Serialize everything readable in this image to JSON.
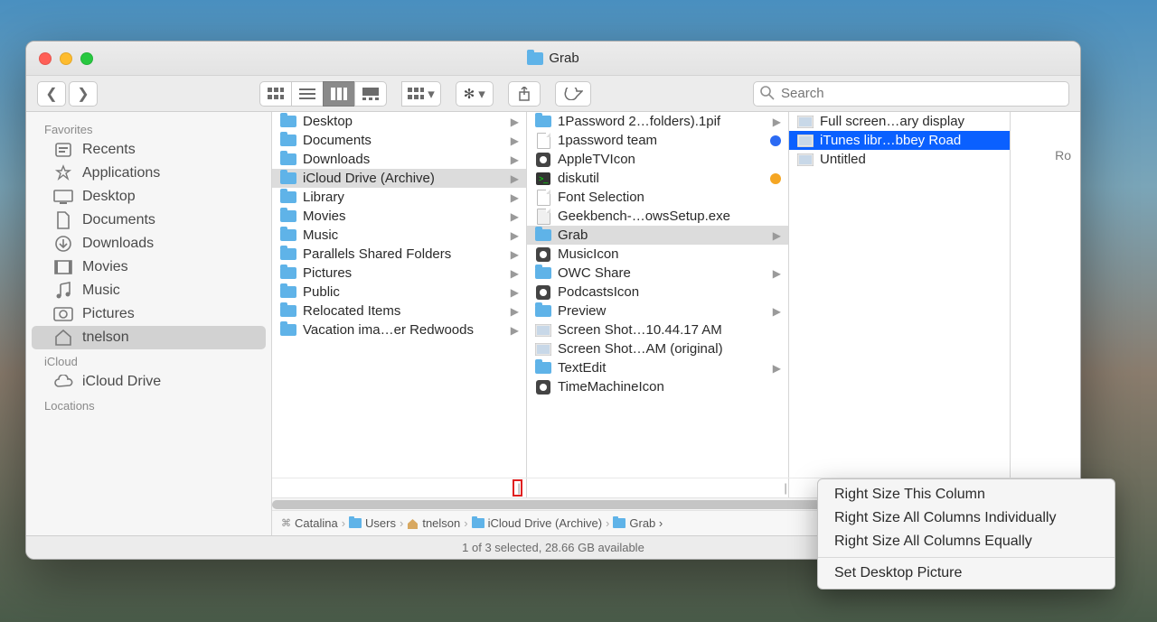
{
  "window": {
    "title": "Grab",
    "search_placeholder": "Search"
  },
  "sidebar": {
    "sections": [
      {
        "title": "Favorites",
        "items": [
          {
            "label": "Recents",
            "icon": "recents"
          },
          {
            "label": "Applications",
            "icon": "apps"
          },
          {
            "label": "Desktop",
            "icon": "desktop"
          },
          {
            "label": "Documents",
            "icon": "documents"
          },
          {
            "label": "Downloads",
            "icon": "downloads"
          },
          {
            "label": "Movies",
            "icon": "movies"
          },
          {
            "label": "Music",
            "icon": "music"
          },
          {
            "label": "Pictures",
            "icon": "pictures"
          },
          {
            "label": "tnelson",
            "icon": "home",
            "selected": true
          }
        ]
      },
      {
        "title": "iCloud",
        "items": [
          {
            "label": "iCloud Drive",
            "icon": "icloud"
          }
        ]
      },
      {
        "title": "Locations",
        "items": []
      }
    ]
  },
  "columns": [
    {
      "items": [
        {
          "label": "Desktop",
          "icon": "folder",
          "arrow": true
        },
        {
          "label": "Documents",
          "icon": "folder",
          "arrow": true
        },
        {
          "label": "Downloads",
          "icon": "folder",
          "arrow": true
        },
        {
          "label": "iCloud Drive (Archive)",
          "icon": "folder",
          "arrow": true,
          "selected": true
        },
        {
          "label": "Library",
          "icon": "folder-lib",
          "arrow": true
        },
        {
          "label": "Movies",
          "icon": "folder",
          "arrow": true
        },
        {
          "label": "Music",
          "icon": "folder",
          "arrow": true
        },
        {
          "label": "Parallels Shared Folders",
          "icon": "folder-share",
          "arrow": true
        },
        {
          "label": "Pictures",
          "icon": "folder",
          "arrow": true
        },
        {
          "label": "Public",
          "icon": "folder",
          "arrow": true
        },
        {
          "label": "Relocated Items",
          "icon": "folder-alias",
          "arrow": true
        },
        {
          "label": "Vacation ima…er Redwoods",
          "icon": "folder",
          "arrow": true
        }
      ]
    },
    {
      "items": [
        {
          "label": "1Password 2…folders).1pif",
          "icon": "folder",
          "arrow": true
        },
        {
          "label": "1password team",
          "icon": "doc",
          "tag": "#2b6af3"
        },
        {
          "label": "AppleTVIcon",
          "icon": "appicon"
        },
        {
          "label": "diskutil",
          "icon": "terminal",
          "tag": "#f5a623"
        },
        {
          "label": "Font Selection",
          "icon": "doc"
        },
        {
          "label": "Geekbench-…owsSetup.exe",
          "icon": "exec"
        },
        {
          "label": "Grab",
          "icon": "folder",
          "arrow": true,
          "selected": true
        },
        {
          "label": "MusicIcon",
          "icon": "appicon"
        },
        {
          "label": "OWC Share",
          "icon": "folder",
          "arrow": true
        },
        {
          "label": "PodcastsIcon",
          "icon": "appicon"
        },
        {
          "label": "Preview",
          "icon": "folder",
          "arrow": true
        },
        {
          "label": "Screen Shot…10.44.17 AM",
          "icon": "image"
        },
        {
          "label": "Screen Shot…AM (original)",
          "icon": "image"
        },
        {
          "label": "TextEdit",
          "icon": "folder",
          "arrow": true
        },
        {
          "label": "TimeMachineIcon",
          "icon": "appicon"
        }
      ]
    },
    {
      "items": [
        {
          "label": "Full screen…ary display",
          "icon": "image"
        },
        {
          "label": "iTunes libr…bbey Road",
          "icon": "image",
          "selected_blue": true
        },
        {
          "label": "Untitled",
          "icon": "image"
        }
      ]
    }
  ],
  "preview_label": "Ro",
  "pathbar": [
    {
      "label": "Catalina",
      "icon": "disk"
    },
    {
      "label": "Users",
      "icon": "folder"
    },
    {
      "label": "tnelson",
      "icon": "home"
    },
    {
      "label": "iCloud Drive (Archive)",
      "icon": "folder"
    },
    {
      "label": "Grab",
      "icon": "folder",
      "truncated": true
    }
  ],
  "status": "1 of 3 selected, 28.66 GB available",
  "context_menu": {
    "items": [
      {
        "label": "Right Size This Column"
      },
      {
        "label": "Right Size All Columns Individually"
      },
      {
        "label": "Right Size All Columns Equally"
      },
      {
        "sep": true
      },
      {
        "label": "Set Desktop Picture"
      }
    ]
  }
}
